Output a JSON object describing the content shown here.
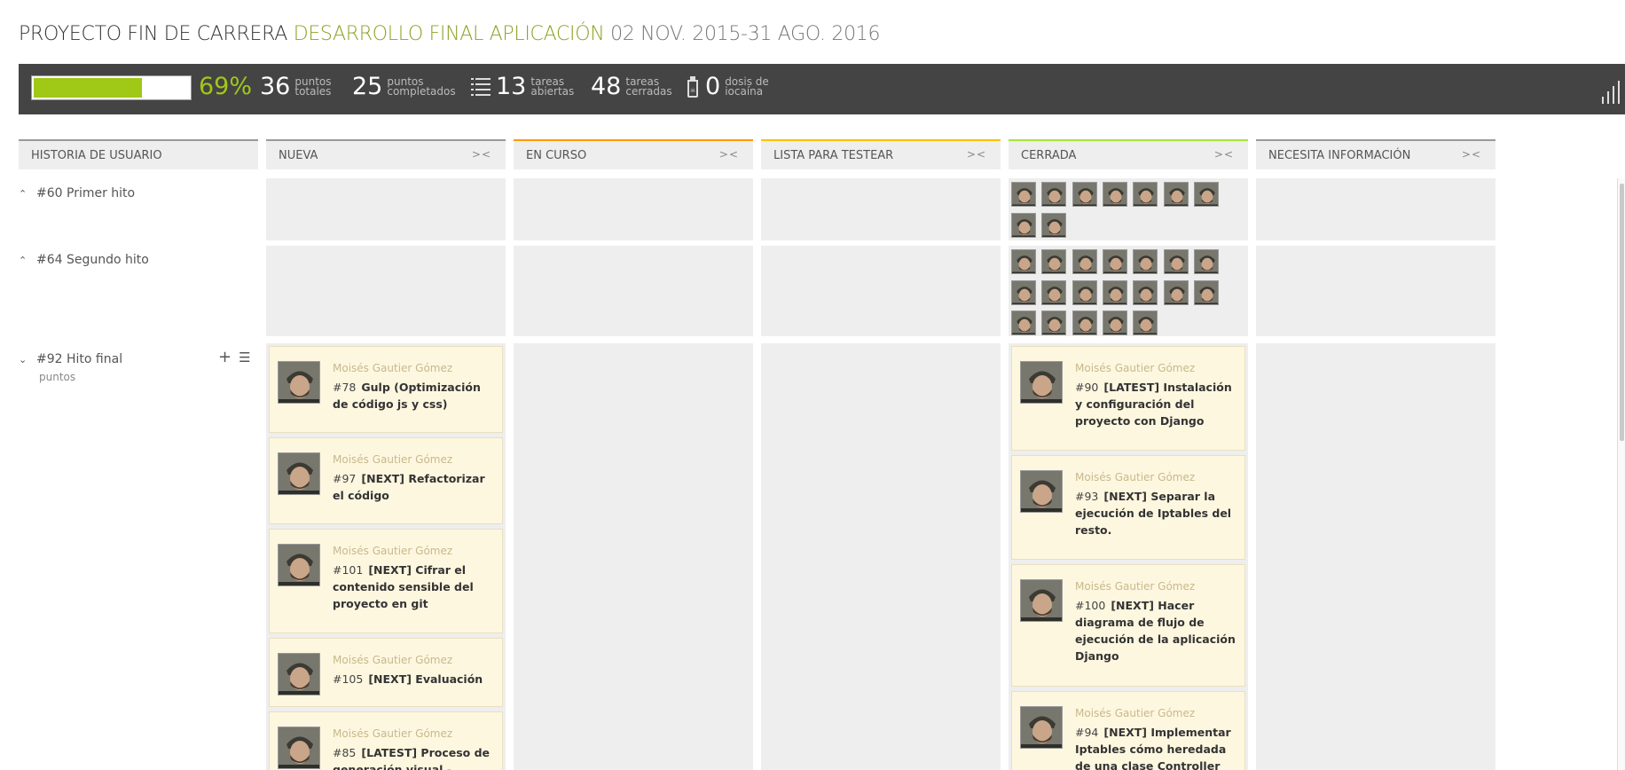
{
  "header": {
    "project": "PROYECTO FIN DE CARRERA",
    "sprint": "DESARROLLO FINAL APLICACIÓN",
    "dates": "02 NOV. 2015-31 AGO. 2016"
  },
  "summary": {
    "progress_pct": "69%",
    "progress_fraction": 0.69,
    "total_points": {
      "value": "36",
      "label1": "puntos",
      "label2": "totales"
    },
    "completed_points": {
      "value": "25",
      "label1": "puntos",
      "label2": "completados"
    },
    "open_tasks": {
      "value": "13",
      "label1": "tareas",
      "label2": "abiertas",
      "icon": "list-icon"
    },
    "closed_tasks": {
      "value": "48",
      "label1": "tareas",
      "label2": "cerradas"
    },
    "iocaine": {
      "value": "0",
      "label1": "dosis de",
      "label2": "iocaína",
      "icon": "iocaine-bottle-icon"
    }
  },
  "columns": {
    "userstory": "HISTORIA DE USUARIO",
    "new": "NUEVA",
    "in_progress": "EN CURSO",
    "ready_for_test": "LISTA PARA TESTEAR",
    "closed": "CERRADA",
    "needs_info": "NECESITA INFORMACIÓN",
    "fold_symbol": "><",
    "colors": {
      "userstory": "#999999",
      "new": "#999999",
      "in_progress": "#ff9900",
      "ready_for_test": "#fcc000",
      "closed": "#a8e440",
      "needs_info": "#999999"
    }
  },
  "rows": {
    "r60": {
      "title": "#60 Primer hito",
      "closed_avatar_count": 9
    },
    "r64": {
      "title": "#64 Segundo hito",
      "closed_avatar_count": 19
    },
    "r92": {
      "title": "#92 Hito final",
      "subtitle": "puntos",
      "add_symbol": "+",
      "list_symbol": "☰"
    }
  },
  "cards_new": [
    {
      "author": "Moisés Gautier Gómez",
      "ref": "#78",
      "subject": "Gulp (Optimización de código js y css)"
    },
    {
      "author": "Moisés Gautier Gómez",
      "ref": "#97",
      "subject": "[NEXT] Refactorizar el código"
    },
    {
      "author": "Moisés Gautier Gómez",
      "ref": "#101",
      "subject": "[NEXT] Cifrar el contenido sensible del proyecto en git"
    },
    {
      "author": "Moisés Gautier Gómez",
      "ref": "#105",
      "subject": "[NEXT] Evaluación"
    },
    {
      "author": "Moisés Gautier Gómez",
      "ref": "#85",
      "subject": "[LATEST] Proceso de generación visual - Reactis -"
    }
  ],
  "cards_closed": [
    {
      "author": "Moisés Gautier Gómez",
      "ref": "#90",
      "subject": "[LATEST] Instalación y configuración del proyecto con Django"
    },
    {
      "author": "Moisés Gautier Gómez",
      "ref": "#93",
      "subject": "[NEXT] Separar la ejecución de Iptables del resto."
    },
    {
      "author": "Moisés Gautier Gómez",
      "ref": "#100",
      "subject": "[NEXT] Hacer diagrama de flujo de ejecución de la aplicación Django"
    },
    {
      "author": "Moisés Gautier Gómez",
      "ref": "#94",
      "subject": "[NEXT] Implementar Iptables cómo heredada de una clase Controller"
    }
  ]
}
